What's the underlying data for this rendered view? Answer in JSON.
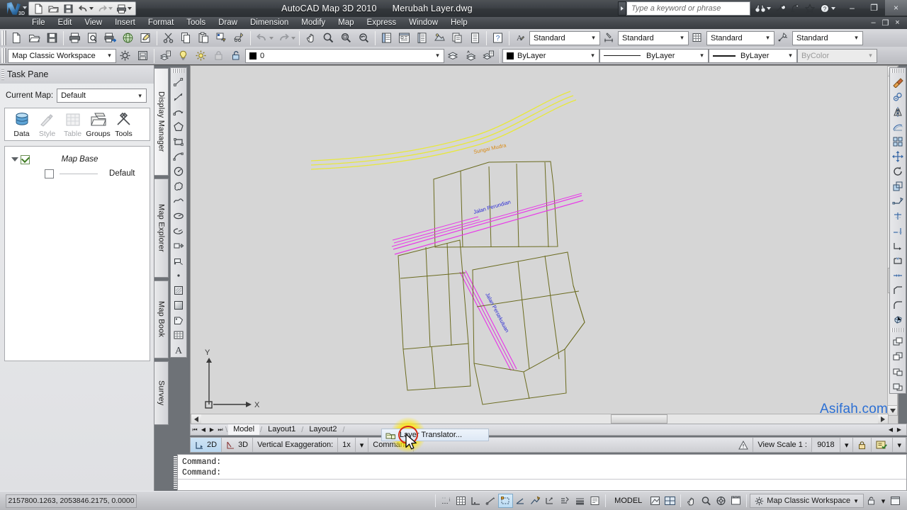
{
  "window": {
    "app_title": "AutoCAD Map 3D 2010",
    "document_title": "Merubah Layer.dwg",
    "app_badge": "3D",
    "minimize": "–",
    "maximize": "❐",
    "close": "×"
  },
  "infocenter": {
    "search_placeholder": "Type a keyword or phrase",
    "icons": [
      "binoculars-icon",
      "wrench-icon",
      "communication-center-icon",
      "favorites-star-icon",
      "help-question-icon"
    ]
  },
  "menubar": {
    "items": [
      "File",
      "Edit",
      "View",
      "Insert",
      "Format",
      "Tools",
      "Draw",
      "Dimension",
      "Modify",
      "Map",
      "Express",
      "Window",
      "Help"
    ]
  },
  "quick_access": {
    "icons": [
      "new-file-icon",
      "open-folder-icon",
      "save-icon",
      "undo-icon",
      "redo-icon",
      "plot-icon"
    ]
  },
  "toolbar_row1": {
    "icons": [
      "qnew-icon",
      "open-icon",
      "save-icon",
      "plot-icon",
      "plot-preview-icon",
      "publish-icon",
      "3dorbit-icon",
      "markup-icon",
      "cut-icon",
      "copy-icon",
      "paste-icon",
      "matchprop-icon",
      "blockeditor-icon",
      "undo-icon",
      "redo-icon",
      "pan-icon",
      "zoom-realtime-icon",
      "zoom-window-icon",
      "zoom-previous-icon",
      "properties-icon",
      "designcenter-icon",
      "toolpalettes-icon",
      "sheetset-icon",
      "markupset-icon",
      "render-icon",
      "help-icon"
    ]
  },
  "toolbar_row2": {
    "workspace_combo": {
      "value": "Map Classic Workspace",
      "name": "workspace-select"
    },
    "layer_combo": {
      "value": "0",
      "name": "layer-select"
    },
    "color_combo": {
      "value": "ByLayer",
      "name": "color-select"
    },
    "linetype_combo": {
      "value": "ByLayer",
      "name": "linetype-select"
    },
    "lineweight_combo": {
      "value": "ByLayer",
      "name": "lineweight-select"
    },
    "plotstyle_combo": {
      "value": "ByColor",
      "name": "plotstyle-select"
    },
    "text_style_combo": {
      "value": "Standard"
    },
    "dim_style_combo": {
      "value": "Standard"
    },
    "table_style_combo": {
      "value": "Standard"
    },
    "mleader_style_combo": {
      "value": "Standard"
    }
  },
  "task_pane": {
    "title": "Task Pane",
    "current_map_label": "Current Map:",
    "current_map_value": "Default",
    "toolbar_items": [
      {
        "label": "Data",
        "icon": "data-cylinder-icon",
        "enabled": true
      },
      {
        "label": "Style",
        "icon": "style-brush-icon",
        "enabled": false
      },
      {
        "label": "Table",
        "icon": "table-grid-icon",
        "enabled": false
      },
      {
        "label": "Groups",
        "icon": "groups-folder-icon",
        "enabled": true
      },
      {
        "label": "Tools",
        "icon": "tools-hammer-icon",
        "enabled": true
      }
    ],
    "tree": {
      "root_label": "Map Base",
      "root_checked": true,
      "child_label": "Default",
      "child_checked": false
    },
    "side_tabs": [
      {
        "label": "Display Manager",
        "active": true
      },
      {
        "label": "Map Explorer",
        "active": false
      },
      {
        "label": "Map Book",
        "active": false
      },
      {
        "label": "Survey",
        "active": false
      }
    ]
  },
  "draw_toolbar": {
    "name": "draw-toolbar",
    "icons": [
      "line-icon",
      "construction-line-icon",
      "polyline-icon",
      "polygon-icon",
      "rectangle-icon",
      "arc-icon",
      "circle-icon",
      "revision-cloud-icon",
      "spline-icon",
      "ellipse-icon",
      "ellipse-arc-icon",
      "insert-block-icon",
      "make-block-icon",
      "point-icon",
      "hatch-icon",
      "gradient-icon",
      "region-icon",
      "table-icon",
      "multiline-text-icon"
    ]
  },
  "modify_toolbar": {
    "name": "modify-toolbar",
    "icons": [
      "erase-icon",
      "copy-icon",
      "mirror-icon",
      "offset-icon",
      "array-icon",
      "move-icon",
      "rotate-icon",
      "scale-icon",
      "stretch-icon",
      "trim-icon",
      "extend-icon",
      "break-at-point-icon",
      "break-icon",
      "join-icon",
      "chamfer-icon",
      "fillet-icon",
      "explode-icon",
      "draworder-front-icon",
      "draworder-back-icon",
      "draworder-above-icon",
      "draworder-below-icon"
    ]
  },
  "canvas": {
    "watermark": "Asifah.com",
    "ucs_x_label": "X",
    "ucs_y_label": "Y",
    "map_labels": [
      {
        "text": "Sungai Mudra",
        "color": "#d98b15",
        "name": "river-label"
      },
      {
        "text": "Jalan Perundian",
        "color": "#2a2ad4",
        "name": "street-label-1"
      },
      {
        "text": "Jalan Persekutuan",
        "color": "#2a2ad4",
        "name": "street-label-2"
      }
    ]
  },
  "layout_tabs": {
    "nav_first": "⏮",
    "nav_prev": "◀",
    "nav_next": "▶",
    "nav_last": "⏭",
    "tabs": [
      {
        "label": "Model",
        "active": true
      },
      {
        "label": "Layout1",
        "active": false
      },
      {
        "label": "Layout2",
        "active": false
      }
    ]
  },
  "status_bar": {
    "view_2d": "2D",
    "view_3d": "3D",
    "vertical_exaggeration_label": "Vertical Exaggeration:",
    "vertical_exaggeration_value": "1x",
    "command_label": "Command",
    "view_scale_label": "View Scale  1 :",
    "view_scale_value": "9018",
    "warning_icon": "warning-triangle-icon",
    "lock_icon": "lock-icon"
  },
  "popup": {
    "menu_item": "Layer Translator...",
    "icon": "layer-translator-icon",
    "highlight_color": "#ffe600",
    "annotation_color": "#d42b16"
  },
  "command_line": {
    "lines": [
      "Command:",
      "Command:"
    ],
    "input_value": ""
  },
  "bottom_bar": {
    "coordinates": "2157800.1263, 2053846.2175, 0.0000",
    "toggles": [
      "infer-constraints-icon",
      "grid-display-icon",
      "snap-mode-icon",
      "ortho-mode-icon",
      "polar-tracking-icon",
      "object-snap-icon",
      "object-snap-tracking-icon",
      "allow-ucs-icon",
      "dynamic-input-icon",
      "lineweight-icon",
      "quick-properties-icon"
    ],
    "space_label": "MODEL",
    "view_icons": [
      "model-space-icon",
      "viewport-icon",
      "pan-icon",
      "zoom-icon",
      "steering-wheel-icon",
      "showmotion-icon"
    ],
    "workspace_label": "Map Classic Workspace",
    "workspace_caret": "▼",
    "right_icons": [
      "toolbar-lock-icon",
      "status-menu-icon",
      "clean-screen-icon"
    ]
  }
}
